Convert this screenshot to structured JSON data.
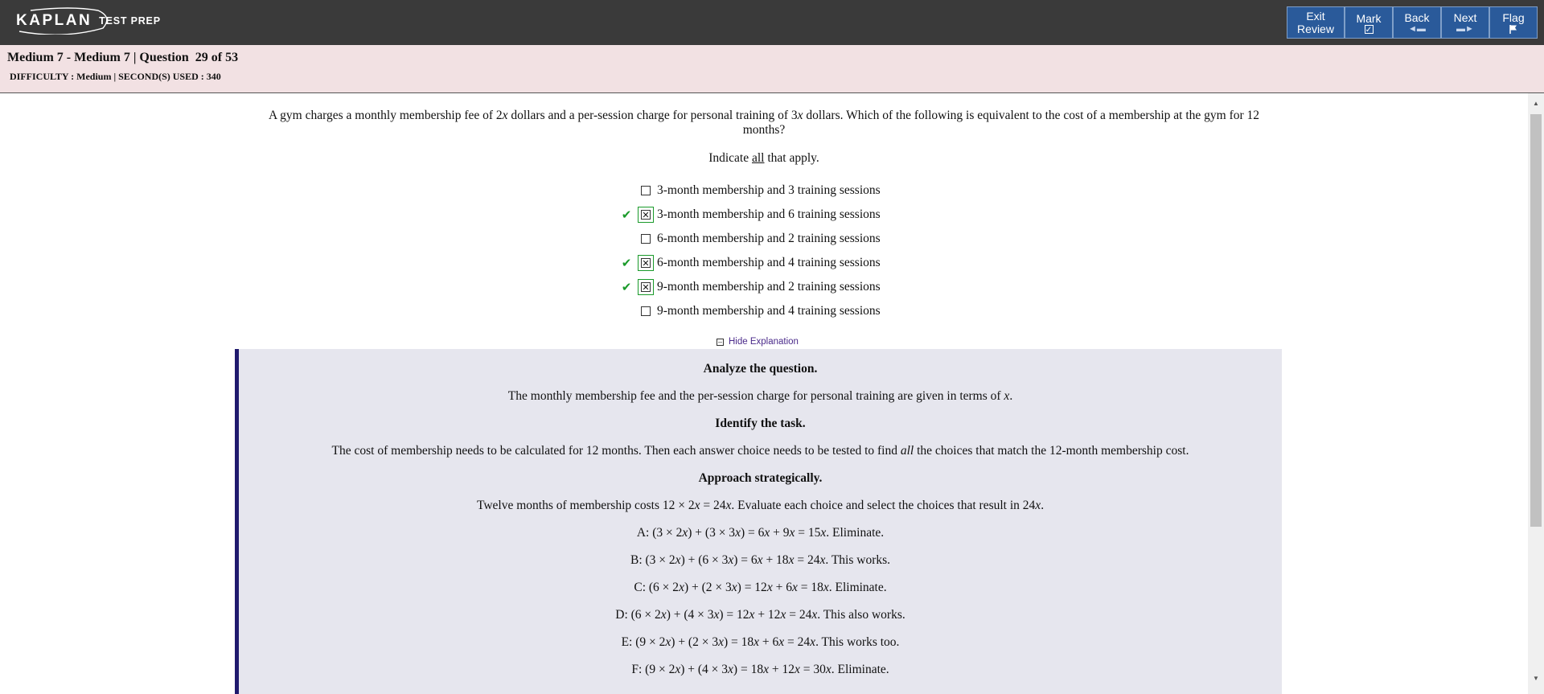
{
  "header": {
    "brand": "KAPLAN",
    "brand_sub": "TEST PREP",
    "buttons": {
      "exit_line1": "Exit",
      "exit_line2": "Review",
      "mark": "Mark",
      "back": "Back",
      "next": "Next",
      "flag": "Flag"
    }
  },
  "info": {
    "title": "Medium 7 - Medium 7 | Question  29 of 53",
    "meta": "DIFFICULTY : Medium | SECOND(S) USED : 340"
  },
  "question": {
    "stem_html": "A gym charges a monthly membership fee of 2<i>x</i> dollars and a per-session charge for personal training of 3<i>x</i> dollars. Which of the following is equivalent to the cost of a membership at the gym for 12 months?",
    "indicate_html": "Indicate <u>all</u> that apply.",
    "choices": [
      {
        "label": "3-month membership and 3 training sessions",
        "selected": false,
        "correct": false
      },
      {
        "label": "3-month membership and 6 training sessions",
        "selected": true,
        "correct": true
      },
      {
        "label": "6-month membership and 2 training sessions",
        "selected": false,
        "correct": false
      },
      {
        "label": "6-month membership and 4 training sessions",
        "selected": true,
        "correct": true
      },
      {
        "label": "9-month membership and 2 training sessions",
        "selected": true,
        "correct": true
      },
      {
        "label": "9-month membership and 4 training sessions",
        "selected": false,
        "correct": false
      }
    ],
    "hide_explanation": "Hide Explanation"
  },
  "explanation": [
    {
      "head": true,
      "html": "Analyze the question."
    },
    {
      "head": false,
      "html": "The monthly membership fee and the per-session charge for personal training are given in terms of <i>x</i>."
    },
    {
      "head": true,
      "html": "Identify the task."
    },
    {
      "head": false,
      "html": "The cost of membership needs to be calculated for 12 months. Then each answer choice needs to be tested to find <i>all</i> the choices that match the 12-month membership cost."
    },
    {
      "head": true,
      "html": "Approach strategically."
    },
    {
      "head": false,
      "html": "Twelve months of membership costs 12 × 2<i>x</i> = 24<i>x</i>. Evaluate each choice and select the choices that result in 24<i>x</i>."
    },
    {
      "head": false,
      "html": "A: (3 × 2<i>x</i>) + (3 × 3<i>x</i>) = 6<i>x</i> + 9<i>x</i> = 15<i>x</i>. Eliminate."
    },
    {
      "head": false,
      "html": "B: (3 × 2<i>x</i>) + (6 × 3<i>x</i>) = 6<i>x</i> + 18<i>x</i> = 24<i>x</i>. This works."
    },
    {
      "head": false,
      "html": "C: (6 × 2<i>x</i>) + (2 × 3<i>x</i>) = 12<i>x</i> + 6<i>x</i> = 18<i>x</i>. Eliminate."
    },
    {
      "head": false,
      "html": "D: (6 × 2<i>x</i>) + (4 × 3<i>x</i>) = 12<i>x</i> + 12<i>x</i> = 24<i>x</i>. This also works."
    },
    {
      "head": false,
      "html": "E: (9 × 2<i>x</i>) + (2 × 3<i>x</i>) = 18<i>x</i> + 6<i>x</i> = 24<i>x</i>. This works too."
    },
    {
      "head": false,
      "html": "F: (9 × 2<i>x</i>) + (4 × 3<i>x</i>) = 18<i>x</i> + 12<i>x</i> = 30<i>x</i>. Eliminate."
    }
  ],
  "colors": {
    "topbar": "#3a3a3a",
    "button": "#2a5a9a",
    "infobar": "#f2e1e3",
    "explanation_bg": "#e6e6ee",
    "explanation_border": "#201a6e",
    "correct_check": "#1a9a2a"
  },
  "icons": {
    "mark": "checkbox-icon",
    "back": "arrow-left-icon",
    "next": "arrow-right-icon",
    "flag": "flag-icon"
  }
}
